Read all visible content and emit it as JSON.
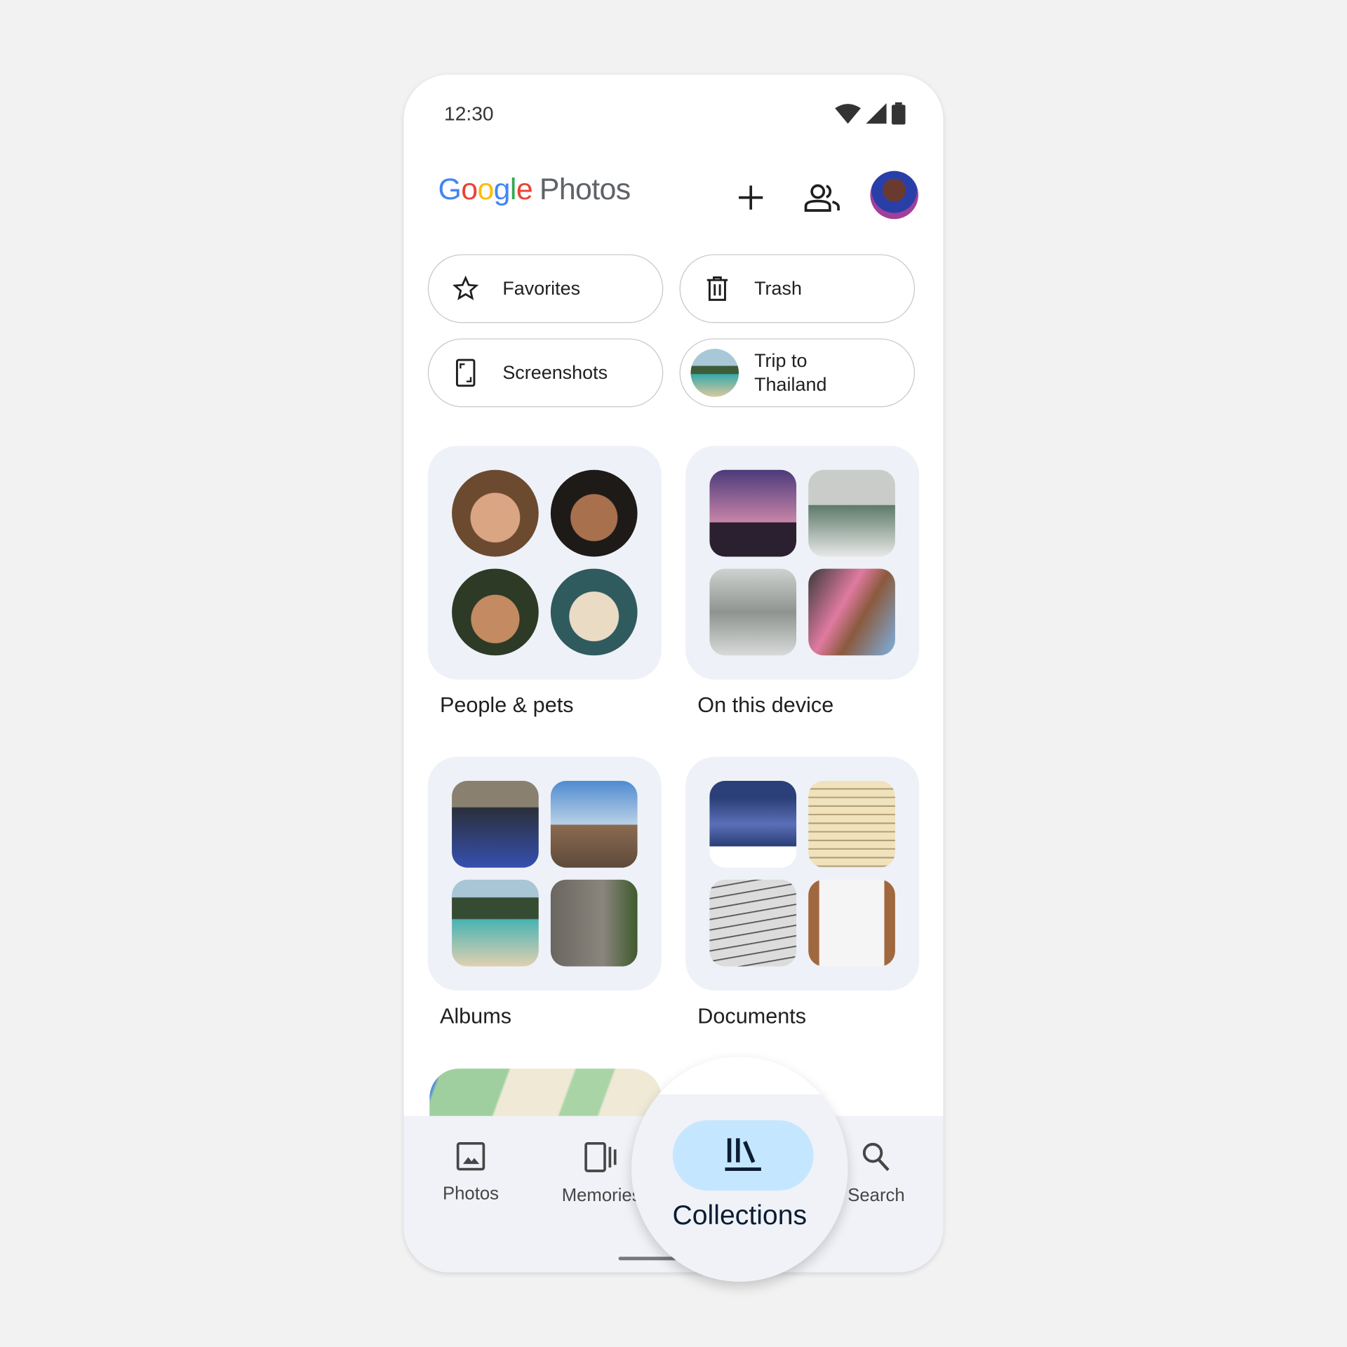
{
  "status_bar": {
    "time": "12:30",
    "icons": [
      "wifi-icon",
      "signal-icon",
      "battery-icon"
    ]
  },
  "header": {
    "logo_google": "Google",
    "logo_photos": "Photos",
    "add_icon": "plus-icon",
    "share_icon": "people-icon",
    "avatar": "profile-avatar"
  },
  "colors": {
    "google_blue": "#4285F4",
    "google_red": "#EA4335",
    "google_yellow": "#FBBC05",
    "google_green": "#34A853",
    "nav_bg": "#f0f2f7",
    "active_pill": "#c4e7ff",
    "card_bg": "#eef1f7"
  },
  "chips": [
    {
      "label": "Favorites",
      "icon": "star-icon"
    },
    {
      "label": "Trash",
      "icon": "trash-icon"
    },
    {
      "label": "Screenshots",
      "icon": "screenshot-icon"
    },
    {
      "label": "Trip to Thailand",
      "icon": "album-thumbnail"
    }
  ],
  "collections": [
    {
      "label": "People & pets"
    },
    {
      "label": "On this device"
    },
    {
      "label": "Albums"
    },
    {
      "label": "Documents"
    }
  ],
  "nav": {
    "items": [
      {
        "label": "Photos",
        "icon": "photo-icon"
      },
      {
        "label": "Memories",
        "icon": "memories-icon"
      },
      {
        "label": "Collections",
        "icon": "collections-icon",
        "active": true
      },
      {
        "label": "Search",
        "icon": "search-icon"
      }
    ]
  }
}
